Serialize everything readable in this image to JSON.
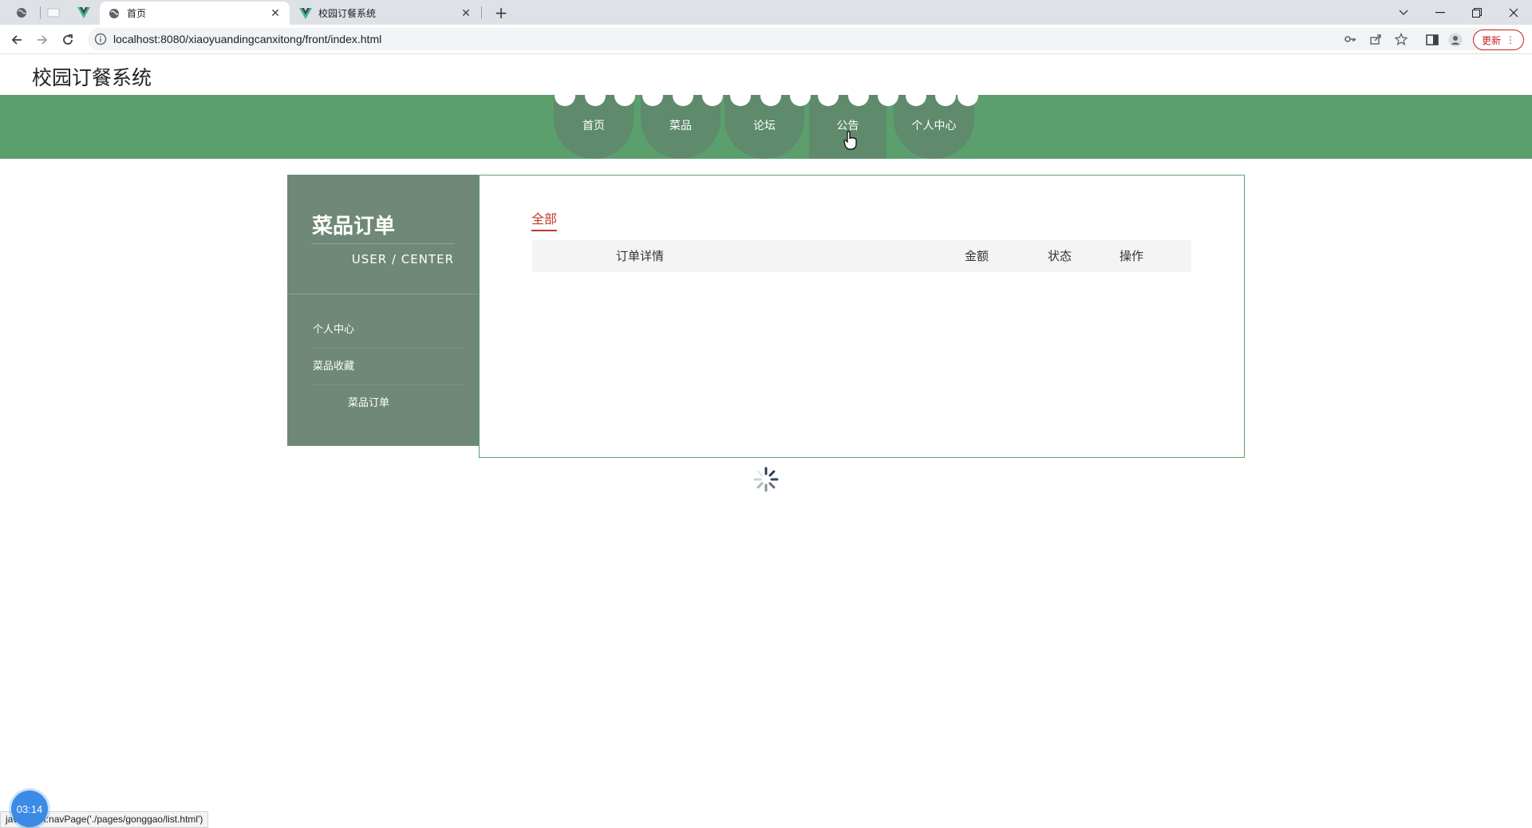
{
  "browser": {
    "tabs": [
      {
        "title": "首页",
        "icon": "globe-icon"
      },
      {
        "title": "校园订餐系统",
        "icon": "vue-icon"
      }
    ],
    "url": "localhost:8080/xiaoyuandingcanxitong/front/index.html",
    "update_label": "更新",
    "status_link": "javascript:navPage('./pages/gonggao/list.html')"
  },
  "site": {
    "title": "校园订餐系统"
  },
  "nav": {
    "items": [
      {
        "label": "首页"
      },
      {
        "label": "菜品"
      },
      {
        "label": "论坛"
      },
      {
        "label": "公告"
      },
      {
        "label": "个人中心"
      }
    ],
    "color": "#5a9f6c",
    "item_color": "#5f8a6c"
  },
  "sidebar": {
    "title": "菜品订单",
    "subtitle": "USER / CENTER",
    "items": [
      {
        "label": "个人中心"
      },
      {
        "label": "菜品收藏"
      },
      {
        "label": "菜品订单"
      }
    ],
    "color": "#6f8878"
  },
  "orders": {
    "filter_tab": "全部",
    "columns": [
      {
        "label": "订单详情"
      },
      {
        "label": "金额"
      },
      {
        "label": "状态"
      },
      {
        "label": "操作"
      }
    ],
    "rows": []
  },
  "overlay": {
    "timer": "03:14"
  }
}
